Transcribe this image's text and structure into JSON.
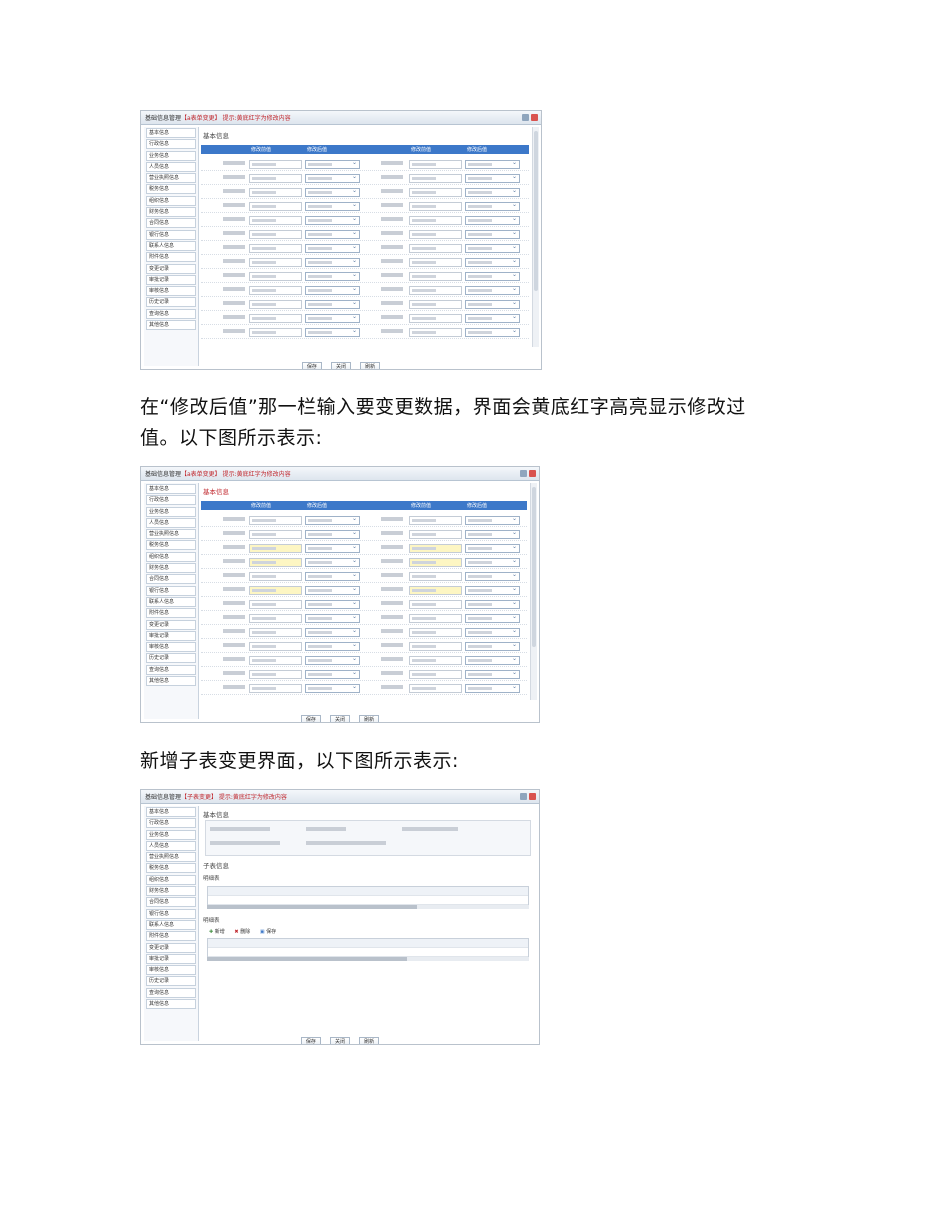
{
  "paragraphs": {
    "p1_line1": "在“修改后值”那一栏输入要变更数据，界面会黄底红字高亮显示修改过",
    "p1_line2": "值。以下图所示表示:",
    "p2": "新增子表变更界面，以下图所示表示:"
  },
  "screens": [
    {
      "title": "基础信息管理",
      "subtitle": "【a表单变更】 提示:黄底红字为修改内容",
      "section": "基本信息",
      "headers": [
        "修改前值",
        "修改后值",
        "修改前值",
        "修改后值"
      ],
      "buttons": [
        "保存",
        "关闭",
        "刷新"
      ],
      "sidebar": [
        "基本信息",
        "行政信息",
        "业务信息",
        "人员信息",
        "营业执照信息",
        "税务信息",
        "组织信息",
        "财务信息",
        "合同信息",
        "银行信息",
        "联系人信息",
        "附件信息",
        "变更记录",
        "审批记录",
        "审核信息",
        "历史记录",
        "查询信息",
        "其他信息"
      ]
    },
    {
      "title": "基础信息管理",
      "subtitle": "【a表单变更】 提示:黄底红字为修改内容",
      "section": "基本信息",
      "headers": [
        "修改前值",
        "修改后值",
        "修改前值",
        "修改后值"
      ],
      "buttons": [
        "保存",
        "关闭",
        "刷新"
      ],
      "sidebar": [
        "基本信息",
        "行政信息",
        "业务信息",
        "人员信息",
        "营业执照信息",
        "税务信息",
        "组织信息",
        "财务信息",
        "合同信息",
        "银行信息",
        "联系人信息",
        "附件信息",
        "变更记录",
        "审批记录",
        "审核信息",
        "历史记录",
        "查询信息",
        "其他信息"
      ]
    },
    {
      "title": "基础信息管理",
      "subtitle": "【子表变更】 提示:黄底红字为修改内容",
      "section": "基本信息",
      "section2": "子表信息",
      "table1": "明细表",
      "table2": "明细表",
      "toolbar": [
        "新增",
        "删除",
        "保存"
      ],
      "buttons": [
        "保存",
        "关闭",
        "刷新"
      ],
      "sidebar": [
        "基本信息",
        "行政信息",
        "业务信息",
        "人员信息",
        "营业执照信息",
        "税务信息",
        "组织信息",
        "财务信息",
        "合同信息",
        "银行信息",
        "联系人信息",
        "附件信息",
        "变更记录",
        "审批记录",
        "审核信息",
        "历史记录",
        "查询信息",
        "其他信息"
      ]
    }
  ],
  "colors": {
    "header_blue": "#3c78c9",
    "highlight_yellow": "#fdf6c3",
    "highlight_red": "#c0262c"
  }
}
